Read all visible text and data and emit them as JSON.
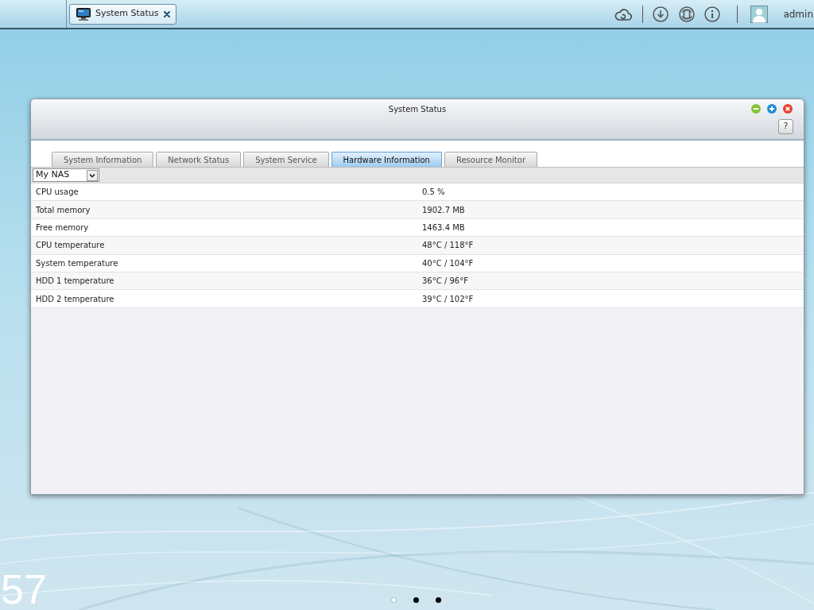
{
  "taskbar": {
    "tasks": [
      {
        "label": "System Status",
        "selected": true
      }
    ],
    "user": "admin"
  },
  "window": {
    "title": "System Status",
    "help": "?",
    "tabs": [
      {
        "label": "System Information",
        "selected": false
      },
      {
        "label": "Network Status",
        "selected": false
      },
      {
        "label": "System Service",
        "selected": false
      },
      {
        "label": "Hardware Information",
        "selected": true
      },
      {
        "label": "Resource Monitor",
        "selected": false
      }
    ],
    "device_select": {
      "value": "My NAS"
    },
    "rows": [
      {
        "label": "CPU usage",
        "value": "0.5 %"
      },
      {
        "label": "Total memory",
        "value": "1902.7 MB"
      },
      {
        "label": "Free memory",
        "value": "1463.4 MB"
      },
      {
        "label": "CPU temperature",
        "value": "48°C / 118°F"
      },
      {
        "label": "System temperature",
        "value": "40°C / 104°F"
      },
      {
        "label": "HDD 1 temperature",
        "value": "36°C / 96°F"
      },
      {
        "label": "HDD 2 temperature",
        "value": "39°C / 102°F"
      }
    ]
  },
  "desktop": {
    "clock": "57",
    "pages": [
      {
        "selected": true
      },
      {
        "selected": false
      },
      {
        "selected": false
      }
    ]
  }
}
